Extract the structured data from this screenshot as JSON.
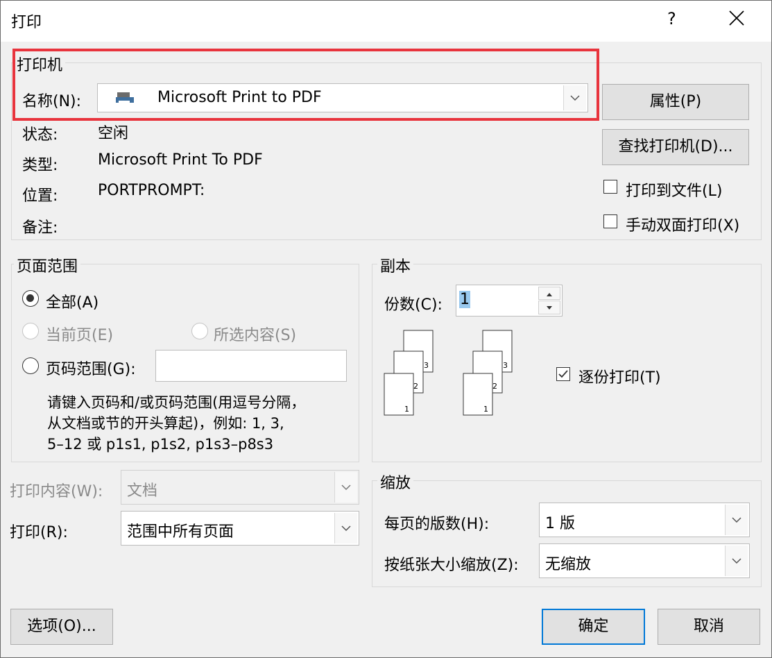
{
  "window": {
    "title": "打印",
    "help": "?",
    "close": "✕"
  },
  "printer": {
    "group_label": "打印机",
    "name_label": "名称(N):",
    "name_value": "Microsoft Print to PDF",
    "status_label": "状态:",
    "status_value": "空闲",
    "type_label": "类型:",
    "type_value": "Microsoft Print To PDF",
    "location_label": "位置:",
    "location_value": "PORTPROMPT:",
    "comment_label": "备注:",
    "properties_button": "属性(P)",
    "find_printer_button": "查找打印机(D)...",
    "print_to_file": "打印到文件(L)",
    "manual_duplex": "手动双面打印(X)"
  },
  "page_range": {
    "group_label": "页面范围",
    "all": "全部(A)",
    "current_page": "当前页(E)",
    "selection": "所选内容(S)",
    "pages": "页码范围(G):",
    "pages_value": "",
    "hint_line1": "请键入页码和/或页码范围(用逗号分隔，",
    "hint_line2": "从文档或节的开头算起)，例如: 1, 3,",
    "hint_line3": "5–12 或 p1s1, p1s2, p1s3–p8s3"
  },
  "copies": {
    "group_label": "副本",
    "count_label": "份数(C):",
    "count_value": "1",
    "collate": "逐份打印(T)",
    "page_numbers": [
      "1",
      "2",
      "3"
    ]
  },
  "print_what": {
    "content_label": "打印内容(W):",
    "content_value": "文档",
    "print_label": "打印(R):",
    "print_value": "范围中所有页面"
  },
  "zoom": {
    "group_label": "缩放",
    "pages_per_sheet_label": "每页的版数(H):",
    "pages_per_sheet_value": "1 版",
    "scale_label": "按纸张大小缩放(Z):",
    "scale_value": "无缩放"
  },
  "footer": {
    "options_button": "选项(O)...",
    "ok_button": "确定",
    "cancel_button": "取消"
  }
}
